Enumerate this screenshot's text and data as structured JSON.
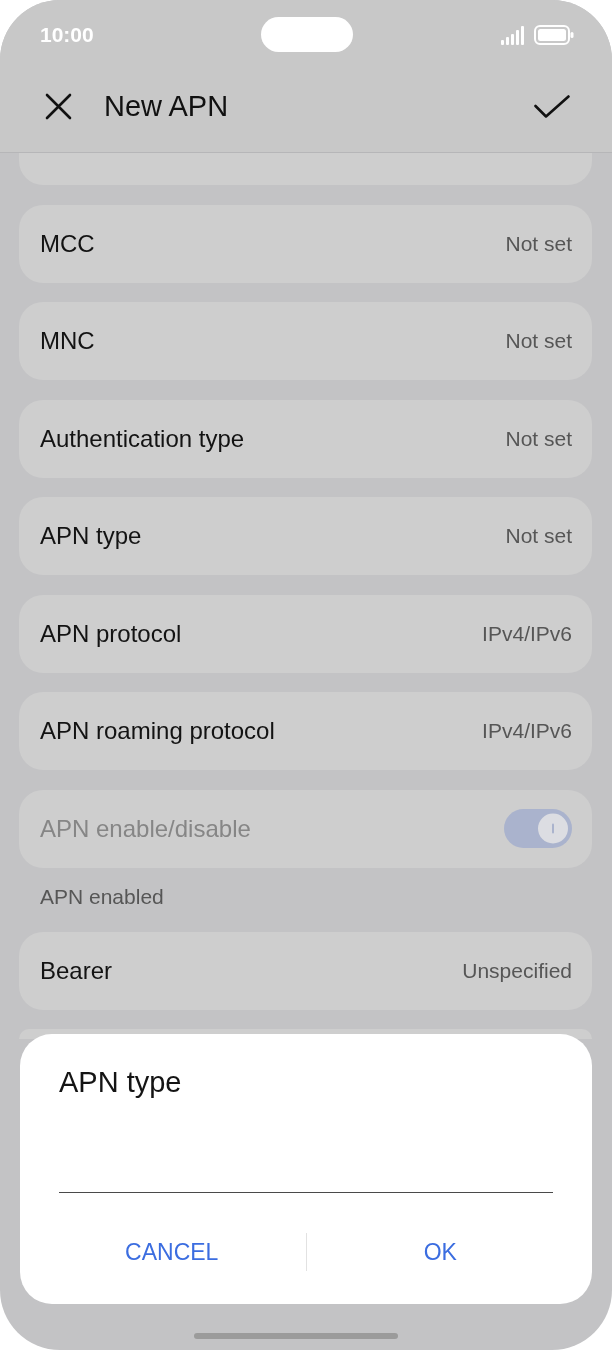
{
  "status_bar": {
    "time": "10:00"
  },
  "header": {
    "title": "New APN"
  },
  "settings": [
    {
      "kind": "value",
      "label": "MCC",
      "value": "Not set"
    },
    {
      "kind": "value",
      "label": "MNC",
      "value": "Not set"
    },
    {
      "kind": "value",
      "label": "Authentication type",
      "value": "Not set"
    },
    {
      "kind": "value",
      "label": "APN type",
      "value": "Not set"
    },
    {
      "kind": "value",
      "label": "APN protocol",
      "value": "IPv4/IPv6"
    },
    {
      "kind": "value",
      "label": "APN roaming protocol",
      "value": "IPv4/IPv6"
    },
    {
      "kind": "toggle",
      "label": "APN enable/disable",
      "on": true,
      "disabled": true,
      "summary": "APN enabled"
    },
    {
      "kind": "value",
      "label": "Bearer",
      "value": "Unspecified"
    }
  ],
  "dialog": {
    "title": "APN type",
    "buttons": [
      "CANCEL",
      "OK"
    ]
  }
}
